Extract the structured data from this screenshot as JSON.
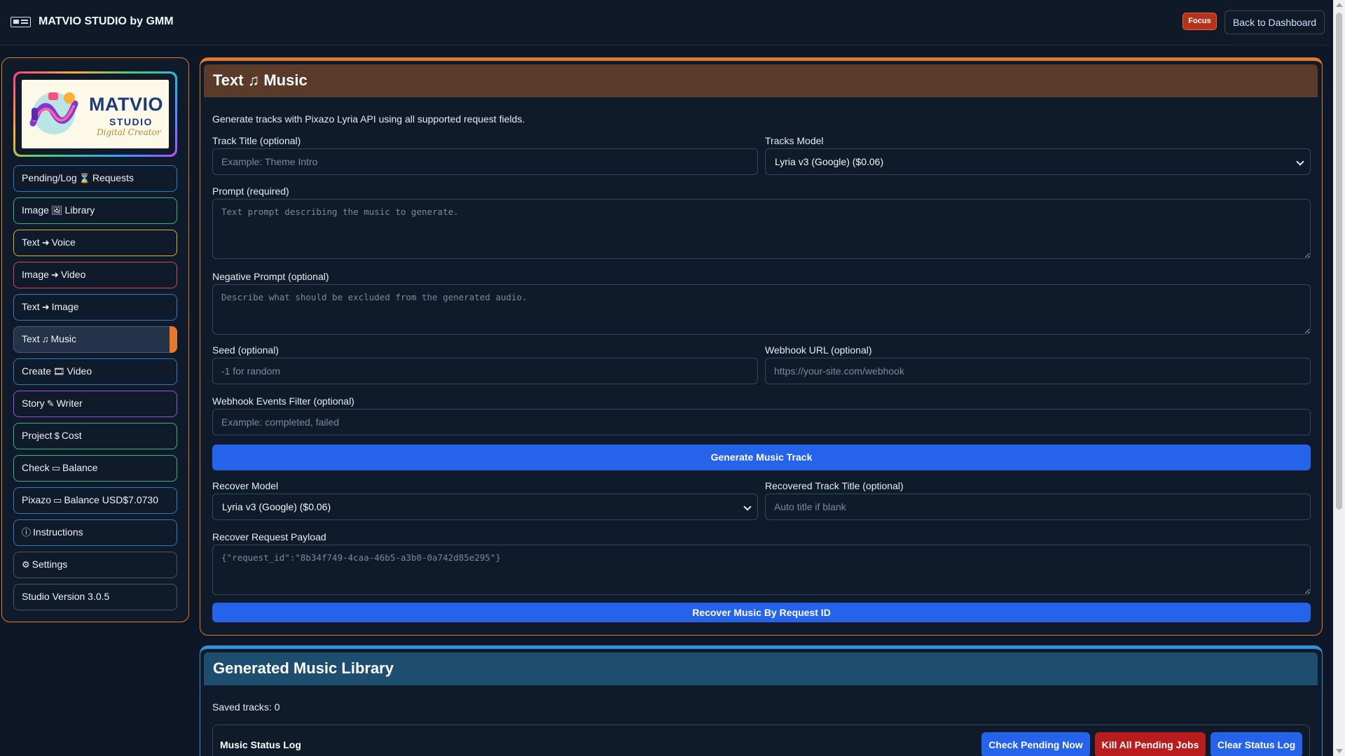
{
  "app": {
    "title": "MATVIO STUDIO by GMM",
    "focus_badge": "Focus",
    "back_button": "Back to Dashboard"
  },
  "logo": {
    "line1": "MATVIO",
    "line2": "STUDIO",
    "line3": "Digital Creator"
  },
  "sidebar": {
    "items": [
      {
        "pre": "Pending/Log",
        "icon": "⌛",
        "post": "Requests",
        "icon_name": "hourglass-icon"
      },
      {
        "pre": "Image",
        "icon": "🖼",
        "post": "Library",
        "icon_name": "image-frame-icon"
      },
      {
        "pre": "Text",
        "icon": "➜",
        "post": "Voice",
        "icon_name": "arrow-circle-icon"
      },
      {
        "pre": "Image",
        "icon": "➜",
        "post": "Video",
        "icon_name": "arrow-circle-icon"
      },
      {
        "pre": "Text",
        "icon": "➜",
        "post": "Image",
        "icon_name": "arrow-circle-icon"
      },
      {
        "pre": "Text",
        "icon": "♫",
        "post": "Music",
        "icon_name": "music-list-icon"
      },
      {
        "pre": "Create",
        "icon": "🎞",
        "post": "Video",
        "icon_name": "film-icon"
      },
      {
        "pre": "Story",
        "icon": "✎",
        "post": "Writer",
        "icon_name": "pencil-square-icon"
      },
      {
        "pre": "Project",
        "icon": "$",
        "post": "Cost",
        "icon_name": "dollar-icon"
      },
      {
        "pre": "Check",
        "icon": "▭",
        "post": "Balance",
        "icon_name": "wallet-icon"
      },
      {
        "pre": "Pixazo",
        "icon": "▭",
        "post": "Balance USD$7.0730",
        "icon_name": "wallet-icon"
      },
      {
        "pre": "",
        "icon": "ⓘ",
        "post": "Instructions",
        "icon_name": "info-icon"
      },
      {
        "pre": "",
        "icon": "⚙",
        "post": "Settings",
        "icon_name": "gear-icon"
      },
      {
        "pre": "Studio Version 3.0.5",
        "icon": "",
        "post": "",
        "icon_name": ""
      }
    ],
    "item_colors": [
      "#2a7ac4",
      "#2fb87a",
      "#e0b12e",
      "#d9465a",
      "#2a7ac4",
      "#3e5e86",
      "#2a7ac4",
      "#9b4fe0",
      "#2fb87a",
      "#2fb87a",
      "#2a7ac4",
      "#2a7ac4",
      "#4a5666",
      "#4a5666"
    ]
  },
  "main": {
    "title_pre": "Text",
    "title_icon": "♫",
    "title_post": "Music",
    "description": "Generate tracks with Pixazo Lyria API using all supported request fields.",
    "track_title_label": "Track Title (optional)",
    "track_title_placeholder": "Example: Theme Intro",
    "tracks_model_label": "Tracks Model",
    "tracks_model_value": "Lyria v3 (Google) ($0.06)",
    "prompt_label": "Prompt (required)",
    "prompt_placeholder": "Text prompt describing the music to generate.",
    "negative_label": "Negative Prompt (optional)",
    "negative_placeholder": "Describe what should be excluded from the generated audio.",
    "seed_label": "Seed (optional)",
    "seed_placeholder": "-1 for random",
    "webhook_label": "Webhook URL (optional)",
    "webhook_placeholder": "https://your-site.com/webhook",
    "events_label": "Webhook Events Filter (optional)",
    "events_placeholder": "Example: completed, failed",
    "generate_button": "Generate Music Track",
    "recover_model_label": "Recover Model",
    "recover_model_value": "Lyria v3 (Google) ($0.06)",
    "recovered_title_label": "Recovered Track Title (optional)",
    "recovered_title_placeholder": "Auto title if blank",
    "payload_label": "Recover Request Payload",
    "payload_placeholder": "{\"request_id\":\"8b34f749-4caa-46b5-a3b0-0a742d85e295\"}",
    "recover_button": "Recover Music By Request ID"
  },
  "library": {
    "title": "Generated Music Library",
    "saved_tracks": "Saved tracks: 0",
    "status_log_title": "Music Status Log",
    "check_pending": "Check Pending Now",
    "kill_jobs": "Kill All Pending Jobs",
    "clear_log": "Clear Status Log"
  }
}
